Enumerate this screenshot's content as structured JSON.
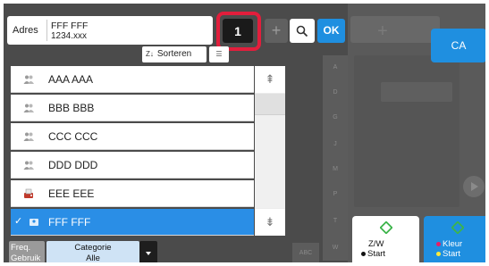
{
  "address": {
    "label": "Adres",
    "name": "FFF FFF",
    "number": "1234.xxx"
  },
  "toolbar": {
    "count": "1",
    "plus_glyph": "+",
    "ok_label": "OK",
    "ca_label": "CA"
  },
  "sort": {
    "label": "Sorteren"
  },
  "contacts": [
    {
      "name": "AAA AAA",
      "icon": "group-icon",
      "selected": false
    },
    {
      "name": "BBB BBB",
      "icon": "group-icon",
      "selected": false
    },
    {
      "name": "CCC CCC",
      "icon": "group-icon",
      "selected": false
    },
    {
      "name": "DDD DDD",
      "icon": "group-icon",
      "selected": false
    },
    {
      "name": "EEE EEE",
      "icon": "fax-icon",
      "selected": false
    },
    {
      "name": "FFF FFF",
      "icon": "person-icon",
      "selected": true
    }
  ],
  "index": {
    "letters": [
      "A",
      "D",
      "G",
      "J",
      "M",
      "P",
      "T",
      "W"
    ],
    "abc_label": "ABC"
  },
  "tabs": {
    "freq_line1": "Freq.",
    "freq_line2": "Gebruik",
    "category_line1": "Categorie",
    "category_line2": "Alle"
  },
  "start": {
    "bw_line1": "Z/W",
    "bw_line2": "Start",
    "color_line1": "Kleur",
    "color_line2": "Start"
  },
  "colors": {
    "accent": "#1f8fe0",
    "highlight": "#e21e3c",
    "start_diamond": "#3cb44a"
  }
}
